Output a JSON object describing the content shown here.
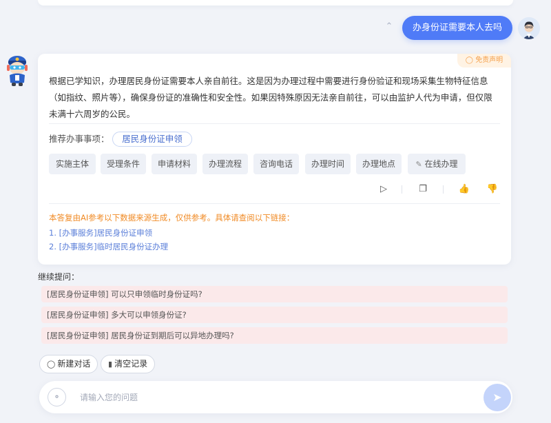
{
  "user_message": {
    "text": "办身份证需要本人去吗"
  },
  "answer": {
    "disclaimer_tag": "免责声明",
    "paragraph": "根据已学知识，办理居民身份证需要本人亲自前往。这是因为办理过程中需要进行身份验证和现场采集生物特征信息（如指纹、照片等），确保身份证的准确性和安全性。如果因特殊原因无法亲自前往，可以由监护人代为申请，但仅限未满十六周岁的公民。",
    "recommend_label": "推荐办事事项：",
    "recommend_item": "居民身份证申领",
    "quick_buttons": [
      "实施主体",
      "受理条件",
      "申请材料",
      "办理流程",
      "咨询电话",
      "办理时间",
      "办理地点",
      "在线办理"
    ],
    "actions": {
      "play": "play-icon",
      "copy": "copy-icon",
      "like": "thumbs-up-icon",
      "dislike": "thumbs-down-icon"
    },
    "ai_note": "本答复由AI参考以下数据来源生成，仅供参考。具体请查阅以下链接：",
    "references": [
      "1. [办事服务]居民身份证申领",
      "2. [办事服务]临时居民身份证办理"
    ]
  },
  "followup": {
    "label": "继续提问：",
    "items": [
      "[居民身份证申领] 可以只申领临时身份证吗?",
      "[居民身份证申领] 多大可以申领身份证?",
      "[居民身份证申领] 居民身份证到期后可以异地办理吗?"
    ]
  },
  "controls": {
    "new_chat": "新建对话",
    "clear_history": "清空记录"
  },
  "input": {
    "placeholder": "请输入您的问题"
  },
  "colors": {
    "accent": "#4f7bf7",
    "note": "#f08a24",
    "link": "#5b7fd9",
    "followup_bg": "#fbe9ea"
  }
}
